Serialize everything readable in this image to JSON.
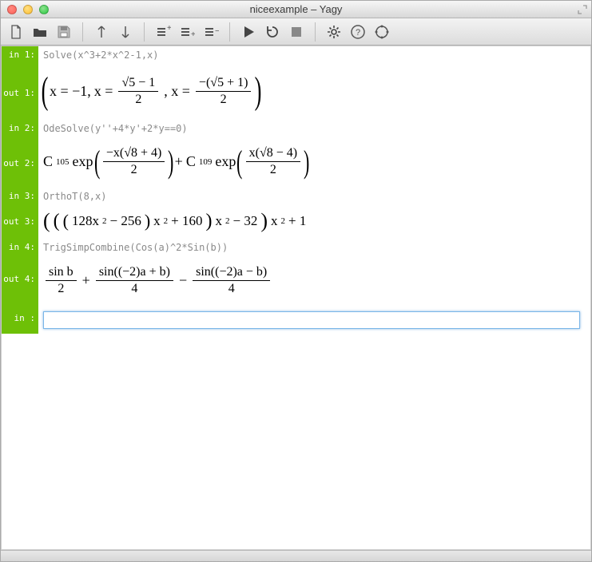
{
  "window": {
    "title": "niceexample – Yagy"
  },
  "toolbar": {
    "new": "New",
    "open": "Open",
    "save": "Save",
    "up": "Up",
    "down": "Down",
    "ins_above": "Insert Above",
    "ins_below": "Insert Below",
    "delete": "Delete Cell",
    "run": "Run",
    "restart": "Restart",
    "stop": "Stop",
    "settings": "Settings",
    "help": "Help",
    "community": "Community"
  },
  "labels": {
    "in1": "in  1:",
    "out1": "out 1:",
    "in2": "in  2:",
    "out2": "out 2:",
    "in3": "in  3:",
    "out3": "out 3:",
    "in4": "in  4:",
    "out4": "out 4:",
    "in_cur": "in   :"
  },
  "cells": {
    "in1": "Solve(x^3+2*x^2-1,x)",
    "in2": "OdeSolve(y''+4*y'+2*y==0)",
    "in3": "OrthoT(8,x)",
    "in4": "TrigSimpCombine(Cos(a)^2*Sin(b))",
    "out1_parts": {
      "x_eq_m1": "x = −1,",
      "x_eq": "x = ",
      "comma_x_eq": " , x = ",
      "frac1_num": "√5 − 1",
      "frac1_den": "2",
      "frac2_num_pre": "−(",
      "frac2_num_mid": "√5 + 1",
      "frac2_num_post": ")",
      "frac2_den": "2"
    },
    "out2_parts": {
      "c105": "C",
      "c105_sub": "105",
      "exp": " exp",
      "frac1_num": "−x(√8 + 4)",
      "frac1_den": "2",
      "plus": " + ",
      "c109": "C",
      "c109_sub": "109",
      "frac2_num": "x(√8 − 4)",
      "frac2_den": "2"
    },
    "out3_parts": {
      "a": "128x",
      "a_sup": "2",
      "b": " − 256",
      "x2": "x",
      "x2_sup": "2",
      "c": " + 160",
      "d": " − 32",
      "e": " + 1"
    },
    "out4_parts": {
      "f1_num": "sin b",
      "f1_den": "2",
      "plus": " + ",
      "f2_num": "sin((−2)a + b)",
      "f2_den": "4",
      "minus": " − ",
      "f3_num": "sin((−2)a − b)",
      "f3_den": "4"
    }
  },
  "input": {
    "value": "",
    "placeholder": ""
  }
}
